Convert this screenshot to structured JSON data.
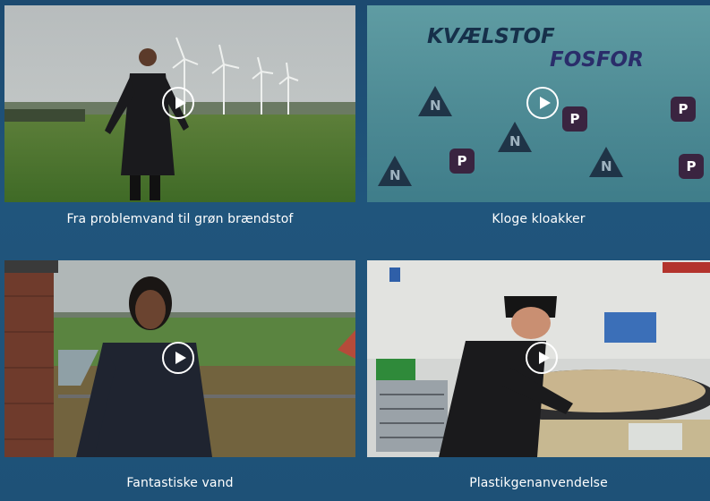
{
  "videos": [
    {
      "title": "Fra problemvand til grøn brændstof"
    },
    {
      "title": "Kloge kloakker",
      "overlay_words": [
        "KVÆLSTOF",
        "FOSFOR"
      ],
      "badge_n": "N",
      "badge_p": "P"
    },
    {
      "title": "Fantastiske vand"
    },
    {
      "title": "Plastikgenanvendelse"
    }
  ],
  "colors": {
    "background": "#1e5177",
    "caption": "#ffffff",
    "kvaelstof": "#16304a",
    "fosfor": "#2a2d6a"
  }
}
